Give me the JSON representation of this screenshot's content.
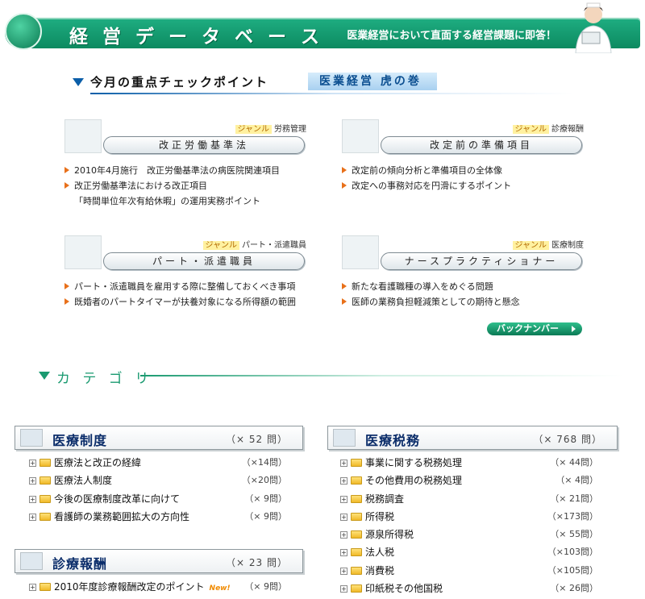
{
  "header": {
    "title": "経 営 デ ー タ ベ ー ス",
    "subtitle": "医業経営において直面する経営課題に即答！"
  },
  "check": {
    "heading": "今月の重点チェックポイント",
    "volume": "医業経営 虎の巻"
  },
  "topics": [
    {
      "genre_tag": "ジャンル",
      "genre": "労務管理",
      "title": "改正労働基準法",
      "items": [
        "2010年4月施行　改正労働基準法の病医院関連項目",
        "改正労働基準法における改正項目"
      ],
      "continuation": "「時間単位年次有給休暇」の運用実務ポイント"
    },
    {
      "genre_tag": "ジャンル",
      "genre": "診療報酬",
      "title": "改定前の準備項目",
      "items": [
        "改定前の傾向分析と準備項目の全体像",
        "改定への事務対応を円滑にするポイント"
      ],
      "continuation": ""
    },
    {
      "genre_tag": "ジャンル",
      "genre": "パート・派遣職員",
      "title": "パート・派遣職員",
      "items": [
        "パート・派遣職員を雇用する際に整備しておくべき事項",
        "既婚者のパートタイマーが扶養対象になる所得額の範囲"
      ],
      "continuation": ""
    },
    {
      "genre_tag": "ジャンル",
      "genre": "医療制度",
      "title": "ナースプラクティショナー",
      "items": [
        "新たな看護職種の導入をめぐる問題",
        "医師の業務負担軽減策としての期待と懸念"
      ],
      "continuation": ""
    }
  ],
  "back_number": "バックナンバー",
  "category_heading": "カ テ ゴ リ",
  "categories": {
    "iryou_seido": {
      "title": "医療制度",
      "count": "（× 52 問）",
      "rows": [
        {
          "label": "医療法と改正の経緯",
          "count": "（×14問）"
        },
        {
          "label": "医療法人制度",
          "count": "（×20問）"
        },
        {
          "label": "今後の医療制度改革に向けて",
          "count": "（× 9問）"
        },
        {
          "label": "看護師の業務範囲拡大の方向性",
          "count": "（× 9問）"
        }
      ]
    },
    "shinryo_houshu": {
      "title": "診療報酬",
      "count": "（× 23 問）",
      "rows": [
        {
          "label": "2010年度診療報酬改定のポイント",
          "badge": "New!",
          "count": "（× 9問）"
        }
      ]
    },
    "iryou_zeimu": {
      "title": "医療税務",
      "count": "（× 768 問）",
      "rows": [
        {
          "label": "事業に関する税務処理",
          "count": "（× 44問）"
        },
        {
          "label": "その他費用の税務処理",
          "count": "（× 4問）"
        },
        {
          "label": "税務調査",
          "count": "（× 21問）"
        },
        {
          "label": "所得税",
          "count": "（×173問）"
        },
        {
          "label": "源泉所得税",
          "count": "（× 55問）"
        },
        {
          "label": "法人税",
          "count": "（×103問）"
        },
        {
          "label": "消費税",
          "count": "（×105問）"
        },
        {
          "label": "印紙税その他国税",
          "count": "（× 26問）"
        }
      ]
    }
  },
  "colors": {
    "brand_green": "#1a9a70",
    "heading_blue": "#0b5ea8",
    "bullet_orange": "#e8701a",
    "category_title": "#0b2d6a"
  }
}
